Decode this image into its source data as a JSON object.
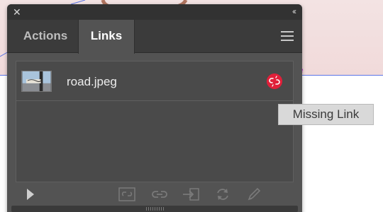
{
  "panel": {
    "close_icon": "close-icon",
    "collapse_icon": "double-chevron-left-icon",
    "tabs": [
      {
        "label": "Actions",
        "active": false
      },
      {
        "label": "Links",
        "active": true
      }
    ],
    "menu_icon": "hamburger-menu-icon"
  },
  "links": [
    {
      "name": "road.jpeg",
      "status": "missing",
      "status_icon": "broken-link-icon",
      "status_color": "#e0203a"
    }
  ],
  "bottom_toolbar": {
    "icons": [
      "play-icon",
      "relink-from-cc-icon",
      "relink-icon",
      "go-to-link-icon",
      "update-link-icon",
      "edit-original-icon"
    ]
  },
  "tooltip": {
    "text": "Missing Link"
  },
  "colors": {
    "panel_bg": "#535353",
    "tabbar_bg": "#3b3b3b",
    "missing_red": "#e0203a",
    "canvas_pink": "#f1dada",
    "guide_blue": "#5b74e6"
  }
}
